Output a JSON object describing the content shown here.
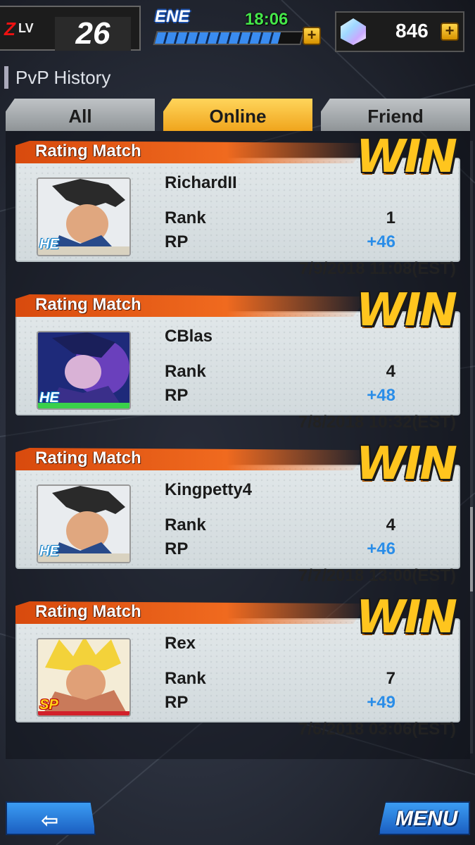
{
  "status": {
    "level_prefix": "Z",
    "level_label": "LV",
    "level": "26",
    "energy_label": "ENE",
    "energy_timer": "18:06",
    "energy_fill": 0.85,
    "gem_count": "846"
  },
  "header": {
    "title": "PvP History"
  },
  "tabs": [
    {
      "label": "All",
      "active": false
    },
    {
      "label": "Online",
      "active": true
    },
    {
      "label": "Friend",
      "active": false
    }
  ],
  "matches": [
    {
      "type": "Rating Match",
      "result": "WIN",
      "name": "RichardII",
      "rank_label": "Rank",
      "rank": "1",
      "rp_label": "RP",
      "rp": "+46",
      "date": "7/9/2018 11:08(EST)",
      "badge": "HE"
    },
    {
      "type": "Rating Match",
      "result": "WIN",
      "name": "CBlas",
      "rank_label": "Rank",
      "rank": "4",
      "rp_label": "RP",
      "rp": "+48",
      "date": "7/8/2018 10:32(EST)",
      "badge": "HE"
    },
    {
      "type": "Rating Match",
      "result": "WIN",
      "name": "Kingpetty4",
      "rank_label": "Rank",
      "rank": "4",
      "rp_label": "RP",
      "rp": "+46",
      "date": "7/7/2018 13:00(EST)",
      "badge": "HE"
    },
    {
      "type": "Rating Match",
      "result": "WIN",
      "name": "Rex",
      "rank_label": "Rank",
      "rank": "7",
      "rp_label": "RP",
      "rp": "+49",
      "date": "7/6/2018 03:06(EST)",
      "badge": "SP"
    }
  ],
  "footer": {
    "back_icon": "back-arrow-icon",
    "menu_label": "MENU"
  },
  "colors": {
    "win": "#ffc51e",
    "rp_positive": "#2a8de8",
    "tab_active": "#f0a51d",
    "banner": "#e85a14"
  }
}
